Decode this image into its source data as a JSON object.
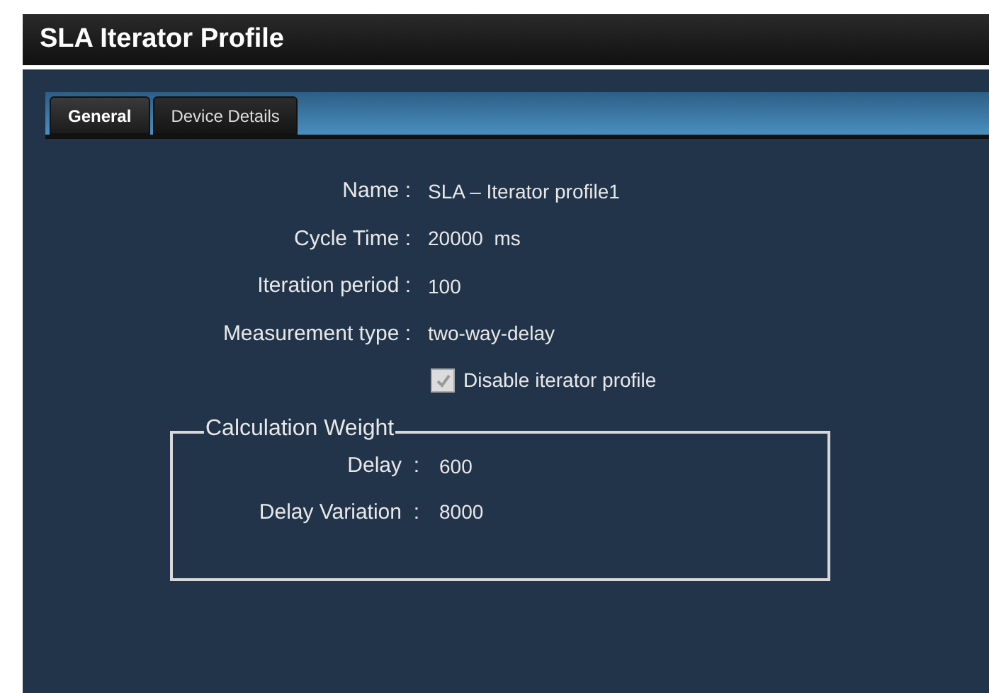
{
  "window": {
    "title": "SLA Iterator Profile"
  },
  "tabs": [
    {
      "label": "General",
      "selected": true
    },
    {
      "label": "Device Details",
      "selected": false
    }
  ],
  "fields": [
    {
      "label": "Name :",
      "value": "SLA – Iterator profile1"
    },
    {
      "label": "Cycle Time :",
      "value": "20000  ms"
    },
    {
      "label": "Iteration period  :",
      "value": "100"
    },
    {
      "label": "Measurement type  :",
      "value": "two-way-delay"
    }
  ],
  "checkbox": {
    "label": "Disable iterator profile",
    "checked": true
  },
  "group": {
    "title": "Calculation Weight",
    "fields": [
      {
        "label": "Delay  :",
        "value": "600"
      },
      {
        "label": "Delay Variation  :",
        "value": "8000"
      }
    ]
  }
}
